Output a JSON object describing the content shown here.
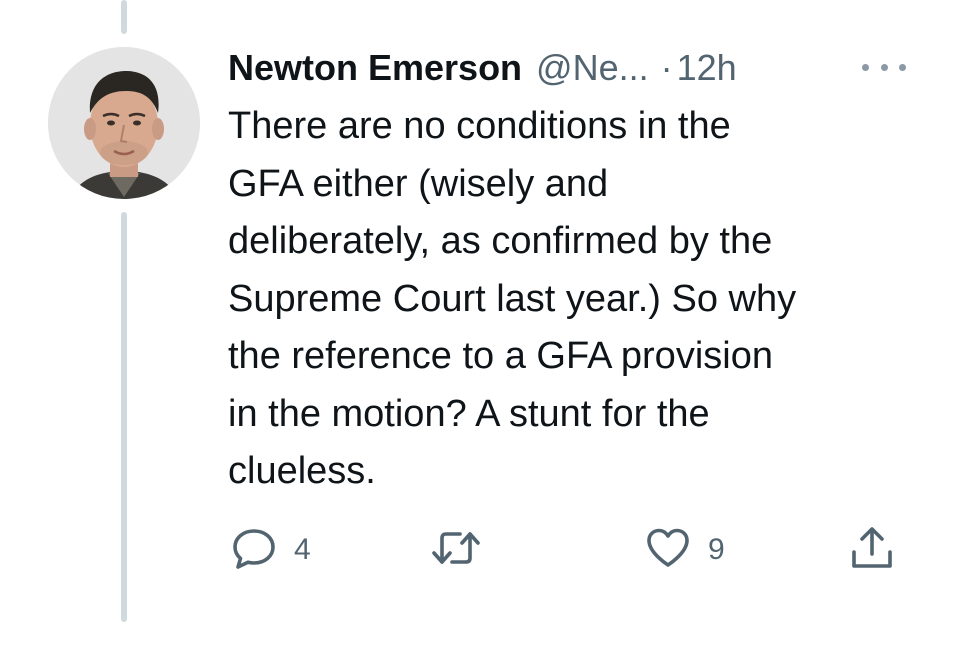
{
  "tweet": {
    "author_name": "Newton Emerson",
    "handle": "@Ne...",
    "separator": "·",
    "time": "12h",
    "text": "There are no conditions in the\nGFA either (wisely and\ndeliberately, as confirmed by the\nSupreme Court last year.) So why\nthe reference to a GFA provision\nin the motion? A stunt for the\nclueless."
  },
  "actions": {
    "reply_count": "4",
    "retweet_count": "",
    "like_count": "9"
  },
  "icons": {
    "reply": "speech-bubble-icon",
    "retweet": "retweet-arrows-icon",
    "like": "heart-icon",
    "share": "share-upload-icon",
    "more": "more-dots-icon"
  },
  "colors": {
    "text_primary": "#0f1419",
    "text_secondary": "#536471",
    "thread_line": "#cfd9de",
    "background": "#ffffff"
  }
}
